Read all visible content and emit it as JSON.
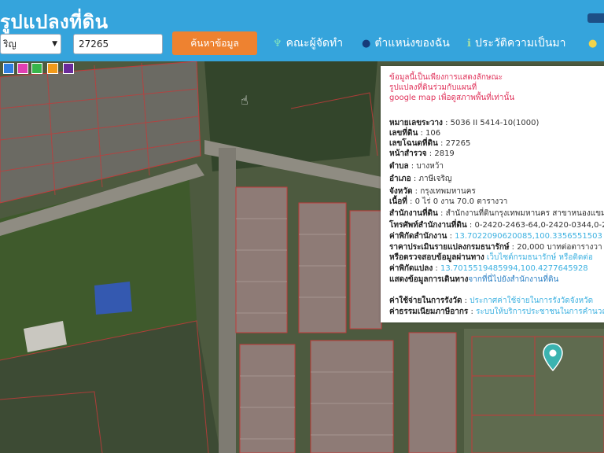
{
  "header": {
    "title": "รูปแปลงที่ดิน"
  },
  "search": {
    "district_selected": "ริญ",
    "parcel_value": "27265",
    "button_label": "ค้นหาข้อมูล"
  },
  "nav": [
    {
      "label": "คณะผู้จัดทำ",
      "icon": "torch-icon"
    },
    {
      "label": "ตำแหน่งของฉัน",
      "icon": "person-pin-icon"
    },
    {
      "label": "ประวัติความเป็นมา",
      "icon": "info-icon"
    },
    {
      "label": "",
      "icon": "lightbulb-icon"
    }
  ],
  "colors": [
    "#2f7fe0",
    "#e23fb2",
    "#37b54a",
    "#f29a1a",
    "#6a2a9a"
  ],
  "popup": {
    "notice": [
      "ข้อมูลนี้เป็นเพียงการแสดงลักษณะ",
      "รูปแปลงที่ดินร่วมกับแผนที่",
      "google map เพื่อดูสภาพพื้นที่เท่านั้น"
    ],
    "fields": [
      {
        "label": "หมายเลขระวาง",
        "value": "5036 II 5414-10(1000)"
      },
      {
        "label": "เลขที่ดิน",
        "value": "106"
      },
      {
        "label": "เลขโฉนดที่ดิน",
        "value": "27265"
      },
      {
        "label": "หน้าสำรวจ",
        "value": "2819"
      },
      {
        "label": "ตำบล",
        "value": "บางหว้า"
      },
      {
        "label": "อำเภอ",
        "value": "ภาษีเจริญ"
      },
      {
        "label": "จังหวัด",
        "value": "กรุงเทพมหานคร"
      },
      {
        "label": "เนื้อที่",
        "value": "0 ไร่ 0 งาน 70.0 ตารางวา"
      },
      {
        "label": "สำนักงานที่ดิน",
        "value": "สำนักงานที่ดินกรุงเทพมหานคร สาขาหนองแขม"
      },
      {
        "label": "โทรศัพท์สำนักงานที่ดิน",
        "value": "0-2420-2463-64,0-2420-0344,0-2"
      },
      {
        "label": "ค่าพิกัดสำนักงาน",
        "value": "13.7022090620085,100.3356551503"
      },
      {
        "label": "ราคาประเมินรายแปลงกรมธนารักษ์",
        "value": "20,000 บาทต่อตารางวา"
      },
      {
        "label": "หรือตรวจสอบข้อมูลผ่านทาง",
        "value": "เว็บไซต์กรมธนารักษ์ หรือติดต่อ"
      },
      {
        "label": "ค่าพิกัดแปลง",
        "value": "13.7015519485994,100.4277645928"
      },
      {
        "label": "แสดงข้อมูลการเดินทาง",
        "value": "จากที่นี่ไปยังสำนักงานที่ดิน"
      },
      {
        "label": "ค่าใช้จ่ายในการรังวัด",
        "value": "ประกาศค่าใช้จ่ายในการรังวัดจังหวัด"
      },
      {
        "label": "ค่าธรรมเนียมภาษีอากร",
        "value": "ระบบให้บริการประชาชนในการคำนวณ"
      }
    ]
  }
}
